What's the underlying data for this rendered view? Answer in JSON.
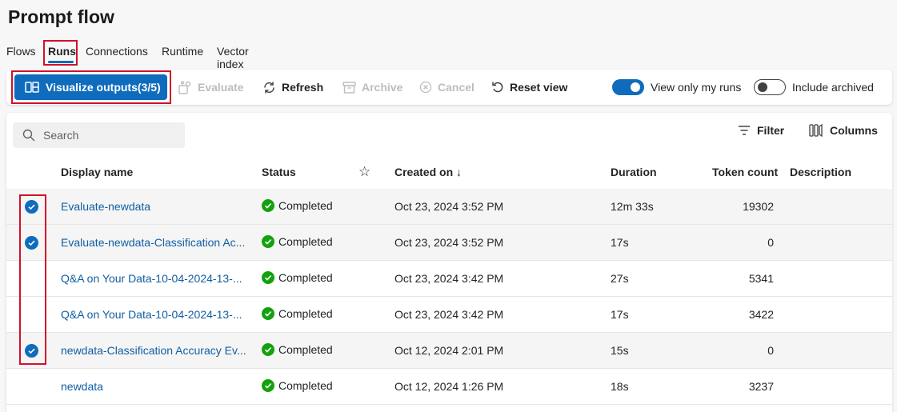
{
  "page_title": "Prompt flow",
  "tabs": [
    {
      "label": "Flows",
      "active": false
    },
    {
      "label": "Runs",
      "active": true
    },
    {
      "label": "Connections",
      "active": false
    },
    {
      "label": "Runtime",
      "active": false
    },
    {
      "label": "Vector index",
      "active": false
    }
  ],
  "toolbar": {
    "visualize_label": "Visualize outputs(3/5)",
    "evaluate_label": "Evaluate",
    "refresh_label": "Refresh",
    "archive_label": "Archive",
    "cancel_label": "Cancel",
    "reset_label": "Reset view",
    "view_mine_label": "View only my runs",
    "view_mine_on": true,
    "include_archived_label": "Include archived",
    "include_archived_on": false
  },
  "search": {
    "placeholder": "Search"
  },
  "panel_actions": {
    "filter_label": "Filter",
    "columns_label": "Columns"
  },
  "table": {
    "columns": [
      "Display name",
      "Status",
      "Created on ↓",
      "Duration",
      "Token count",
      "Description"
    ],
    "rows": [
      {
        "name": "Evaluate-newdata",
        "status": "Completed",
        "created": "Oct 23, 2024 3:52 PM",
        "duration": "12m 33s",
        "tokens": "19302",
        "selected": true
      },
      {
        "name": "Evaluate-newdata-Classification Ac...",
        "status": "Completed",
        "created": "Oct 23, 2024 3:52 PM",
        "duration": "17s",
        "tokens": "0",
        "selected": true
      },
      {
        "name": "Q&A on Your Data-10-04-2024-13-...",
        "status": "Completed",
        "created": "Oct 23, 2024 3:42 PM",
        "duration": "27s",
        "tokens": "5341",
        "selected": false
      },
      {
        "name": "Q&A on Your Data-10-04-2024-13-...",
        "status": "Completed",
        "created": "Oct 23, 2024 3:42 PM",
        "duration": "17s",
        "tokens": "3422",
        "selected": false
      },
      {
        "name": "newdata-Classification Accuracy Ev...",
        "status": "Completed",
        "created": "Oct 12, 2024 2:01 PM",
        "duration": "15s",
        "tokens": "0",
        "selected": true
      },
      {
        "name": "newdata",
        "status": "Completed",
        "created": "Oct 12, 2024 1:26 PM",
        "duration": "18s",
        "tokens": "3237",
        "selected": false
      }
    ]
  },
  "colors": {
    "accent": "#0f6cbd",
    "success": "#13a10e",
    "highlight": "#d0112b",
    "link": "#115ea3"
  }
}
